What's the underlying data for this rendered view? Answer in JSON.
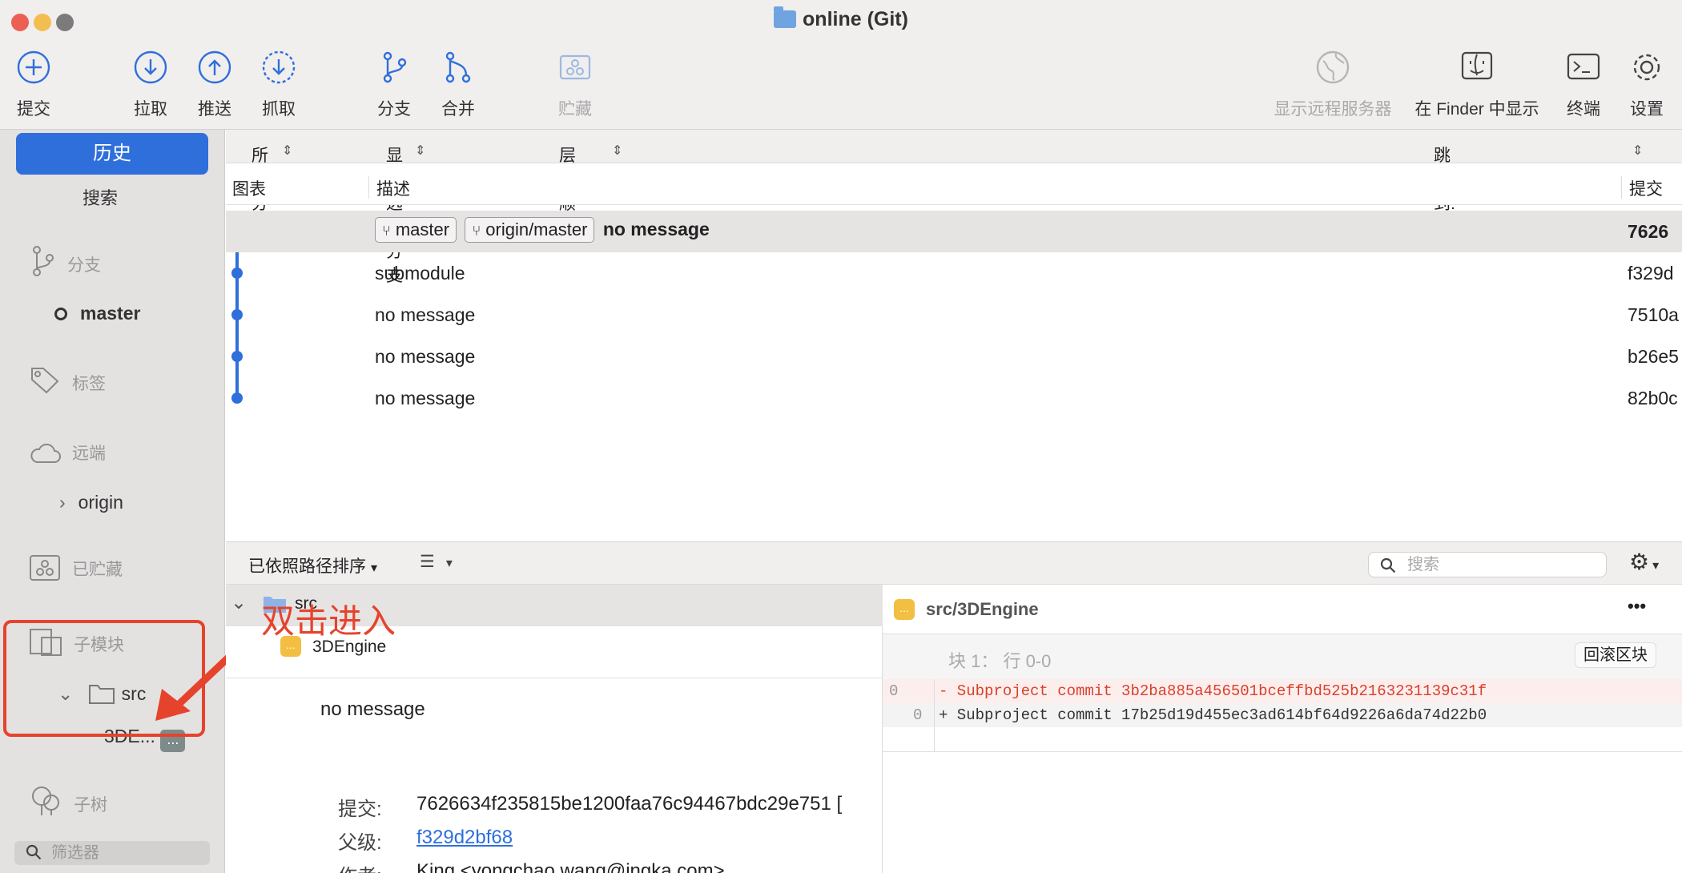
{
  "window": {
    "title": "online (Git)"
  },
  "toolbar": {
    "commit": "提交",
    "pull": "拉取",
    "push": "推送",
    "fetch": "抓取",
    "branch": "分支",
    "merge": "合并",
    "stash": "贮藏",
    "show_remote": "显示远程服务器",
    "show_in_finder": "在 Finder 中显示",
    "terminal": "终端",
    "settings": "设置"
  },
  "sidebar": {
    "history": "历史",
    "search": "搜索",
    "branches": "分支",
    "branch_master": "master",
    "tags": "标签",
    "remotes": "远端",
    "remote_origin": "origin",
    "stashes": "已贮藏",
    "submodules": "子模块",
    "submodule_folder": "src",
    "submodule_item": "3DE...",
    "submodule_badge": "...",
    "subtrees": "子树",
    "filter_placeholder": "筛选器"
  },
  "filters": {
    "all_branches": "所有分支",
    "show_remote_branches": "显示远程分支",
    "order": "层级顺序",
    "jump_to": "跳转到:"
  },
  "columns": {
    "graph": "图表",
    "description": "描述",
    "commit": "提交"
  },
  "commits": [
    {
      "branch1": "master",
      "branch2": "origin/master",
      "message": "no message",
      "hash": "7626"
    },
    {
      "message": "submodule",
      "hash": "f329d"
    },
    {
      "message": "no message",
      "hash": "7510a"
    },
    {
      "message": "no message",
      "hash": "b26e5"
    },
    {
      "message": "no message",
      "hash": "82b0c"
    }
  ],
  "lower": {
    "sort_label": "已依照路径排序",
    "search_placeholder": "搜索"
  },
  "files": {
    "folder": "src",
    "file": "3DEngine",
    "badge": "..."
  },
  "details": {
    "message": "no message",
    "commit_label": "提交:",
    "commit_value": "7626634f235815be1200faa76c94467bdc29e751 [",
    "parent_label": "父级:",
    "parent_value": "f329d2bf68",
    "author_label": "作者:",
    "author_value": "King <yongchao.wang@ingka.com>"
  },
  "diff": {
    "path": "src/3DEngine",
    "badge": "...",
    "more": "•••",
    "hunk": "块 1： 行 0-0",
    "revert": "回滚区块",
    "line_old_no": "0",
    "line_old": "- Subproject commit 3b2ba885a456501bceffbd525b2163231139c31f",
    "line_new_no": "0",
    "line_new": "+ Subproject commit 17b25d19d455ec3ad614bf64d9226a6da74d22b0"
  },
  "annotation": {
    "text": "双击进入"
  },
  "colors": {
    "accent": "#2e6fdc",
    "annotation": "#e5432b",
    "deleted": "#d9412a",
    "tag": "#f2bf42"
  }
}
